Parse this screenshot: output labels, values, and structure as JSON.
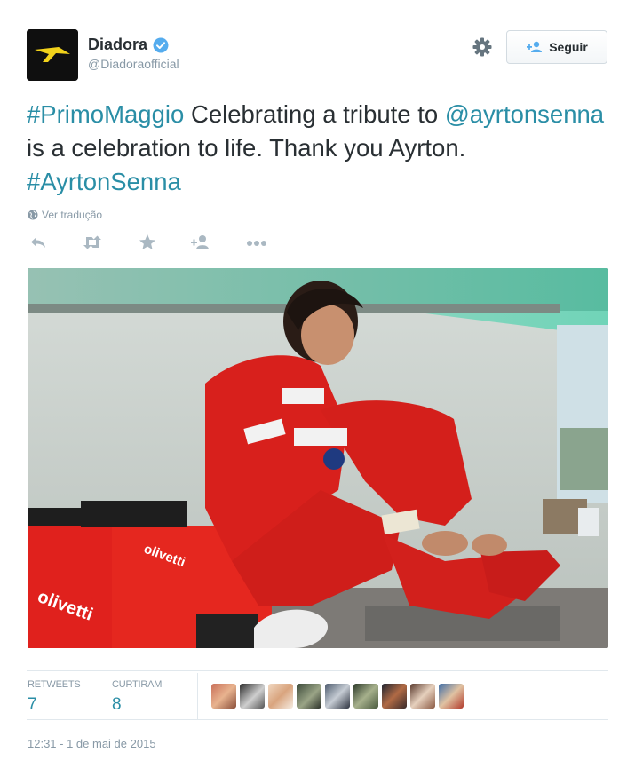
{
  "author": {
    "name": "Diadora",
    "handle": "@Diadoraofficial",
    "verified": true,
    "avatar_icon": "diadora-logo"
  },
  "header": {
    "settings_icon": "gear-icon",
    "follow_label": "Seguir"
  },
  "tweet": {
    "segments": [
      {
        "text": "#PrimoMaggio",
        "link": true
      },
      {
        "text": " Celebrating a tribute to ",
        "link": false
      },
      {
        "text": "@ayrtonsenna",
        "link": true
      },
      {
        "text": " is a celebration to life. Thank you Ayrton. ",
        "link": false
      },
      {
        "text": "#AyrtonSenna",
        "link": true
      }
    ],
    "translate_label": "Ver tradução"
  },
  "actions": [
    "reply-icon",
    "retweet-icon",
    "favorite-icon",
    "follow-icon",
    "more-icon"
  ],
  "stats": {
    "retweets_label": "RETWEETS",
    "retweets_value": "7",
    "likes_label": "CURTIRAM",
    "likes_value": "8"
  },
  "liker_count": 8,
  "timestamp": "12:31 - 1 de mai de 2015",
  "colors": {
    "link": "#2a8ea6",
    "muted": "#8899a6",
    "verified": "#55acee",
    "text": "#292f33"
  }
}
